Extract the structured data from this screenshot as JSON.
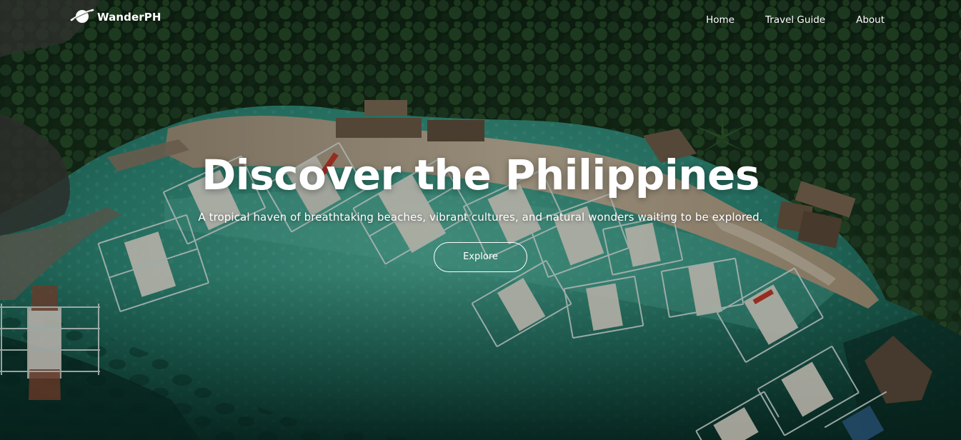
{
  "brand": {
    "name": "WanderPH",
    "logo_icon": "globe-orbit-icon"
  },
  "nav": {
    "items": [
      {
        "label": "Home"
      },
      {
        "label": "Travel Guide"
      },
      {
        "label": "About"
      }
    ]
  },
  "hero": {
    "title": "Discover the Philippines",
    "subtitle": "A tropical haven of breathtaking beaches, vibrant cultures, and natural wonders waiting to be explored.",
    "cta_label": "Explore",
    "background": "aerial-photo-island-beach-boats"
  },
  "colors": {
    "text": "#ffffff",
    "water": "#2f8f7c",
    "jungle": "#1f3a22",
    "sand": "#b9ab94"
  }
}
